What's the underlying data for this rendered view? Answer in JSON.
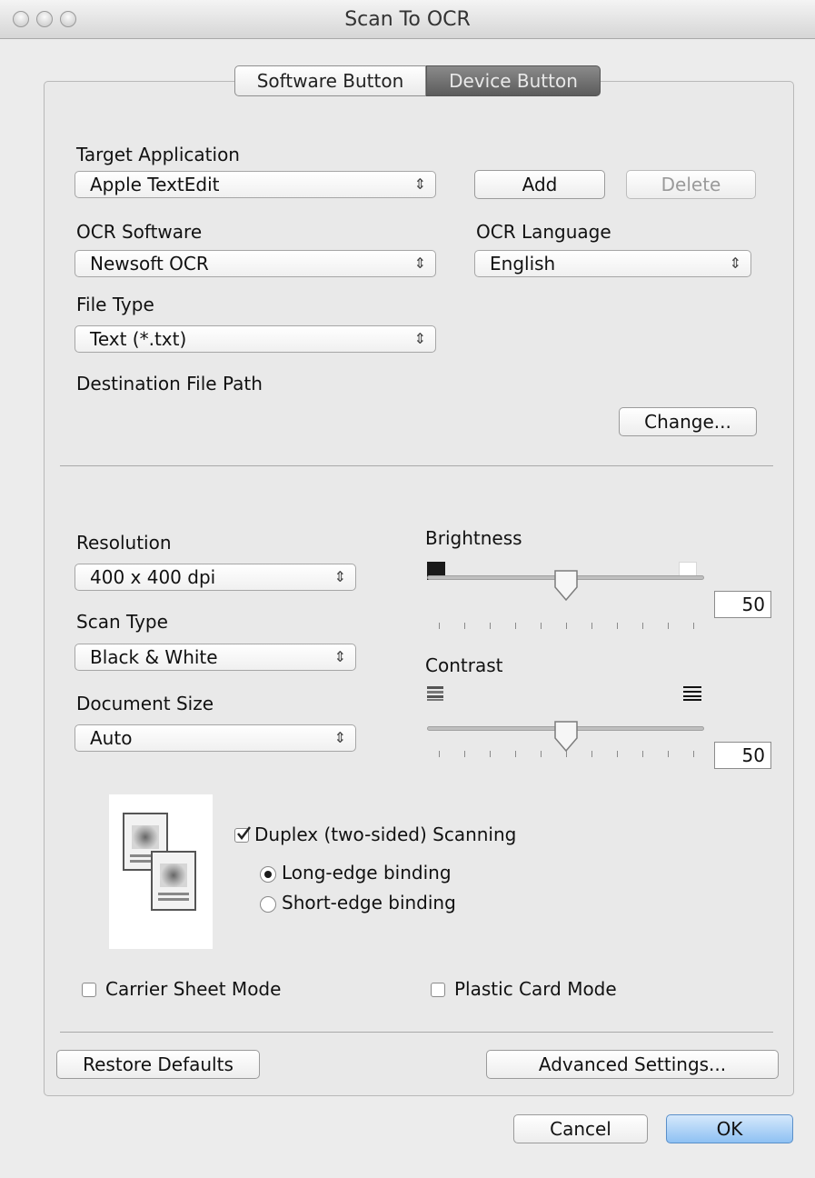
{
  "window": {
    "title": "Scan To OCR"
  },
  "tabs": [
    {
      "label": "Software Button",
      "selected": false
    },
    {
      "label": "Device Button",
      "selected": true
    }
  ],
  "target_application": {
    "label": "Target Application",
    "value": "Apple TextEdit",
    "add_label": "Add",
    "delete_label": "Delete"
  },
  "ocr_software": {
    "label": "OCR Software",
    "value": "Newsoft OCR"
  },
  "ocr_language": {
    "label": "OCR Language",
    "value": "English"
  },
  "file_type": {
    "label": "File Type",
    "value": "Text (*.txt)"
  },
  "destination": {
    "label": "Destination File Path",
    "change_label": "Change..."
  },
  "resolution": {
    "label": "Resolution",
    "value": "400 x 400 dpi"
  },
  "scan_type": {
    "label": "Scan Type",
    "value": "Black & White"
  },
  "document_size": {
    "label": "Document Size",
    "value": "Auto"
  },
  "brightness": {
    "label": "Brightness",
    "value": "50",
    "level": 0.5
  },
  "contrast": {
    "label": "Contrast",
    "value": "50",
    "level": 0.5
  },
  "duplex": {
    "label": "Duplex (two-sided) Scanning",
    "checked": true,
    "long_edge": "Long-edge binding",
    "short_edge": "Short-edge binding",
    "selected_binding": "long"
  },
  "carrier_sheet": {
    "label": "Carrier Sheet Mode",
    "checked": false
  },
  "plastic_card": {
    "label": "Plastic Card Mode",
    "checked": false
  },
  "buttons": {
    "restore": "Restore Defaults",
    "advanced": "Advanced Settings...",
    "cancel": "Cancel",
    "ok": "OK"
  },
  "colors": {
    "ok_button": "#8ec1f3",
    "active_tab": "#6e6e6e",
    "window_bg": "#ececec"
  },
  "icons": [
    "close-icon",
    "minimize-icon",
    "zoom-icon",
    "updown-arrows-icon",
    "black-square-icon",
    "white-square-icon",
    "low-contrast-icon",
    "high-contrast-icon",
    "duplex-document-icon",
    "checkmark-icon"
  ]
}
